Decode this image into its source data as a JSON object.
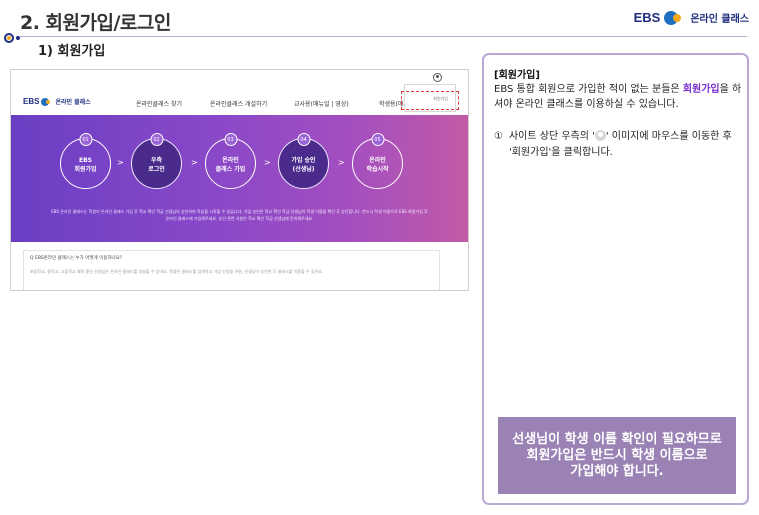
{
  "header": {
    "title": "2. 회원가입/로그인",
    "brand_ebs": "EBS",
    "brand_text": "온라인 클래스"
  },
  "section": {
    "title": "1) 회원가입"
  },
  "screenshot": {
    "brand_ebs": "EBS",
    "brand_text": "온라인 클래스",
    "menu": [
      "온라인클래스 찾기",
      "온라인클래스 개설하기",
      "교사용(매뉴얼 | 영상)",
      "학생용(매뉴얼"
    ],
    "dropdown_item": "회원가입",
    "steps": [
      {
        "num": "01",
        "label": "EBS\n회원가입"
      },
      {
        "num": "02",
        "label": "우측\n로그인"
      },
      {
        "num": "03",
        "label": "온라인\n클래스 가입"
      },
      {
        "num": "04",
        "label": "가입 승인\n(선생님)"
      },
      {
        "num": "05",
        "label": "온라인\n학습시작"
      }
    ],
    "arrow": ">",
    "banner_note": "EBS 온라인 클래스는 학생이 온라인 클래스 가입 후 학교 확인 학급 선생님의 승인하여 학습을 시작할 수 있습니다. 가입 승인은 학교 확인 학급 선생님이 학생 이름을 확인 후 승인합니다. 반드시 학생 이름으로 EBS 회원가입 후 온라인 클래스에 가입해주세요. 승인 관련 사항은 학교 확인 학급 선생님께 문의해주세요.",
    "faq_question": "Q  EBS온라인 클래스는 누가 어떻게 이용하나요?",
    "faq_answer": "초등학교, 중학교, 고등학교 재학 중인 선생님은 온라인 클래스를 개설할 수 있어요. 학생은 클래스를 검색하고 가입 신청을 하면, 선생님이 승인한 후 클래스를 이용할 수 있어요."
  },
  "panel": {
    "heading": "[회원가입]",
    "intro_before": "EBS 통합 회원으로 가입한 적이 없는 분들은 ",
    "intro_highlight": "회원가입",
    "intro_after": "을 하셔야 온라인 클래스를 이용하실 수 있습니다.",
    "step_mark": "①",
    "step_text_before": "사이트 상단 우측의 '",
    "step_text_after": "' 이미지에 마우스를 이동한 후 '회원가입'을 클릭합니다.",
    "notice": "선생님이 학생 이름 확인이 필요하므로\n회원가입은 반드시 학생 이름으로\n가입해야 합니다."
  },
  "colors": {
    "accent": "#b9a7d6",
    "highlight": "#7a2fd0",
    "notice_bg": "#9b82b5",
    "brand_blue": "#1f2f80",
    "brand_orange": "#f2a81d",
    "dropdown_highlight": "#e53935"
  }
}
